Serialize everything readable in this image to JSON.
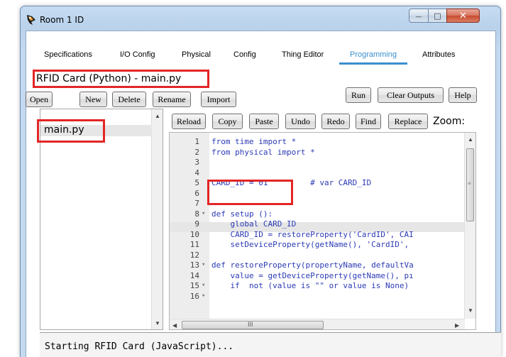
{
  "window": {
    "title": "Room 1 ID",
    "close_glyph": "✕",
    "min_glyph": "—",
    "max_glyph": "□"
  },
  "tabs": [
    {
      "label": "Specifications"
    },
    {
      "label": "I/O Config"
    },
    {
      "label": "Physical"
    },
    {
      "label": "Config"
    },
    {
      "label": "Thing Editor"
    },
    {
      "label": "Programming",
      "active": true
    },
    {
      "label": "Attributes"
    }
  ],
  "file_header": "RFID Card (Python) - main.py",
  "file_toolbar": {
    "open": "Open",
    "new": "New",
    "delete": "Delete",
    "rename": "Rename",
    "import": "Import",
    "run": "Run",
    "clear_outputs": "Clear Outputs",
    "help": "Help"
  },
  "editor_toolbar": {
    "reload": "Reload",
    "copy": "Copy",
    "paste": "Paste",
    "undo": "Undo",
    "redo": "Redo",
    "find": "Find",
    "replace": "Replace",
    "zoom_label": "Zoom:"
  },
  "file_list": {
    "items": [
      "main.py"
    ]
  },
  "code_lines": [
    {
      "n": "1",
      "fold": "",
      "text": "from time import *"
    },
    {
      "n": "2",
      "fold": "",
      "text": "from physical import *"
    },
    {
      "n": "3",
      "fold": "",
      "text": ""
    },
    {
      "n": "4",
      "fold": "",
      "text": ""
    },
    {
      "n": "5",
      "fold": "",
      "text": "CARD_ID = 01         # var CARD_ID"
    },
    {
      "n": "6",
      "fold": "",
      "text": ""
    },
    {
      "n": "7",
      "fold": "",
      "text": ""
    },
    {
      "n": "8",
      "fold": "▾",
      "text": "def setup ():"
    },
    {
      "n": "9",
      "fold": "",
      "text": "    global CARD_ID"
    },
    {
      "n": "10",
      "fold": "",
      "text": "    CARD_ID = restoreProperty('CardID', CAI"
    },
    {
      "n": "11",
      "fold": "",
      "text": "    setDeviceProperty(getName(), 'CardID',"
    },
    {
      "n": "12",
      "fold": "",
      "text": ""
    },
    {
      "n": "13",
      "fold": "▾",
      "text": "def restoreProperty(propertyName, defaultVa"
    },
    {
      "n": "14",
      "fold": "",
      "text": "    value = getDeviceProperty(getName(), pı"
    },
    {
      "n": "15",
      "fold": "▾",
      "text": "    if  not (value is \"\" or value is None)"
    },
    {
      "n": "16",
      "fold": "▾",
      "text": ""
    }
  ],
  "hscroll_thumb_glyph": "III",
  "output": {
    "text": "Starting RFID Card (JavaScript)..."
  }
}
